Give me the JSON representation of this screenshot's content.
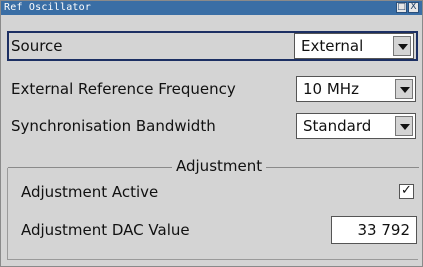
{
  "window": {
    "title": "Ref Oscillator",
    "buttons": [
      "□",
      "X"
    ]
  },
  "source": {
    "label": "Source",
    "value": "External"
  },
  "ext_freq": {
    "label": "External Reference Frequency",
    "value": "10 MHz"
  },
  "sync_bw": {
    "label": "Synchronisation Bandwidth",
    "value": "Standard"
  },
  "adjustment": {
    "legend": "Adjustment",
    "active_label": "Adjustment Active",
    "active_checked": true,
    "dac_label": "Adjustment DAC Value",
    "dac_value": "33 792"
  },
  "colors": {
    "titlebar": "#3a6ea5",
    "selection_border": "#1c2f63",
    "panel": "#d4d4d4"
  }
}
